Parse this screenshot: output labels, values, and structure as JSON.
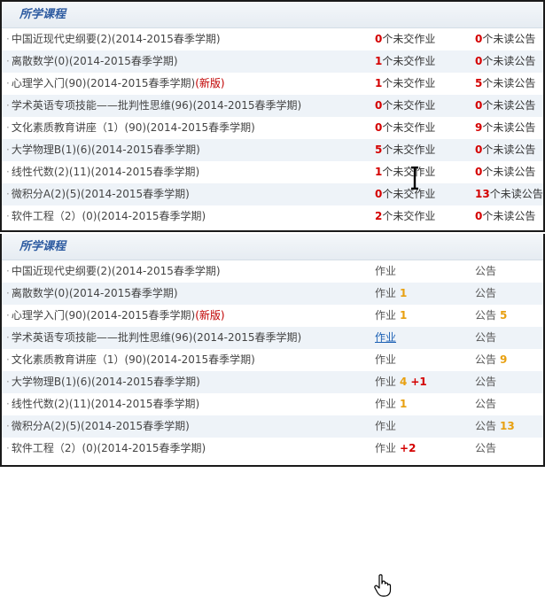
{
  "top": {
    "title": "所学课程",
    "rows": [
      {
        "name": "中国近现代史纲要(2)(2014-2015春季学期)",
        "tag": "",
        "hw_count": "0",
        "hw_text": "个未交作业",
        "an_count": "0",
        "an_text": "个未读公告"
      },
      {
        "name": "离散数学(0)(2014-2015春季学期)",
        "tag": "",
        "hw_count": "1",
        "hw_text": "个未交作业",
        "an_count": "0",
        "an_text": "个未读公告"
      },
      {
        "name": "心理学入门(90)(2014-2015春季学期)",
        "tag": "(新版)",
        "hw_count": "1",
        "hw_text": "个未交作业",
        "an_count": "5",
        "an_text": "个未读公告"
      },
      {
        "name": "学术英语专项技能——批判性思维(96)(2014-2015春季学期)",
        "tag": "",
        "hw_count": "0",
        "hw_text": "个未交作业",
        "an_count": "0",
        "an_text": "个未读公告"
      },
      {
        "name": "文化素质教育讲座（1）(90)(2014-2015春季学期)",
        "tag": "",
        "hw_count": "0",
        "hw_text": "个未交作业",
        "an_count": "9",
        "an_text": "个未读公告"
      },
      {
        "name": "大学物理B(1)(6)(2014-2015春季学期)",
        "tag": "",
        "hw_count": "5",
        "hw_text": "个未交作业",
        "an_count": "0",
        "an_text": "个未读公告"
      },
      {
        "name": "线性代数(2)(11)(2014-2015春季学期)",
        "tag": "",
        "hw_count": "1",
        "hw_text": "个未交作业",
        "an_count": "0",
        "an_text": "个未读公告"
      },
      {
        "name": "微积分A(2)(5)(2014-2015春季学期)",
        "tag": "",
        "hw_count": "0",
        "hw_text": "个未交作业",
        "an_count": "13",
        "an_text": "个未读公告"
      },
      {
        "name": "软件工程（2）(0)(2014-2015春季学期)",
        "tag": "",
        "hw_count": "2",
        "hw_text": "个未交作业",
        "an_count": "0",
        "an_text": "个未读公告"
      }
    ]
  },
  "bottom": {
    "title": "所学课程",
    "hw_label": "作业",
    "an_label": "公告",
    "rows": [
      {
        "name": "中国近现代史纲要(2)(2014-2015春季学期)",
        "tag": "",
        "hw_num": "",
        "hw_plus": "",
        "an_num": ""
      },
      {
        "name": "离散数学(0)(2014-2015春季学期)",
        "tag": "",
        "hw_num": "1",
        "hw_plus": "",
        "an_num": ""
      },
      {
        "name": "心理学入门(90)(2014-2015春季学期)",
        "tag": "(新版)",
        "hw_num": "1",
        "hw_plus": "",
        "an_num": "5"
      },
      {
        "name": "学术英语专项技能——批判性思维(96)(2014-2015春季学期)",
        "tag": "",
        "hw_num": "",
        "hw_plus": "",
        "an_num": ""
      },
      {
        "name": "文化素质教育讲座（1）(90)(2014-2015春季学期)",
        "tag": "",
        "hw_num": "",
        "hw_plus": "",
        "an_num": "9"
      },
      {
        "name": "大学物理B(1)(6)(2014-2015春季学期)",
        "tag": "",
        "hw_num": "4",
        "hw_plus": "+1",
        "an_num": ""
      },
      {
        "name": "线性代数(2)(11)(2014-2015春季学期)",
        "tag": "",
        "hw_num": "1",
        "hw_plus": "",
        "an_num": ""
      },
      {
        "name": "微积分A(2)(5)(2014-2015春季学期)",
        "tag": "",
        "hw_num": "",
        "hw_plus": "",
        "an_num": "13"
      },
      {
        "name": "软件工程（2）(0)(2014-2015春季学期)",
        "tag": "",
        "hw_num": "",
        "hw_plus": "+2",
        "an_num": ""
      }
    ]
  },
  "colors": {
    "count_red": "#d40000",
    "count_orange": "#e8a010",
    "header_text": "#2c5aa0",
    "alt_row": "#eef3f8",
    "link_hover": "#1a5fb4"
  },
  "icons": {
    "text_cursor": "i-beam-cursor-icon",
    "pointer_cursor": "hand-pointer-cursor-icon",
    "bullet": "bullet-icon"
  }
}
